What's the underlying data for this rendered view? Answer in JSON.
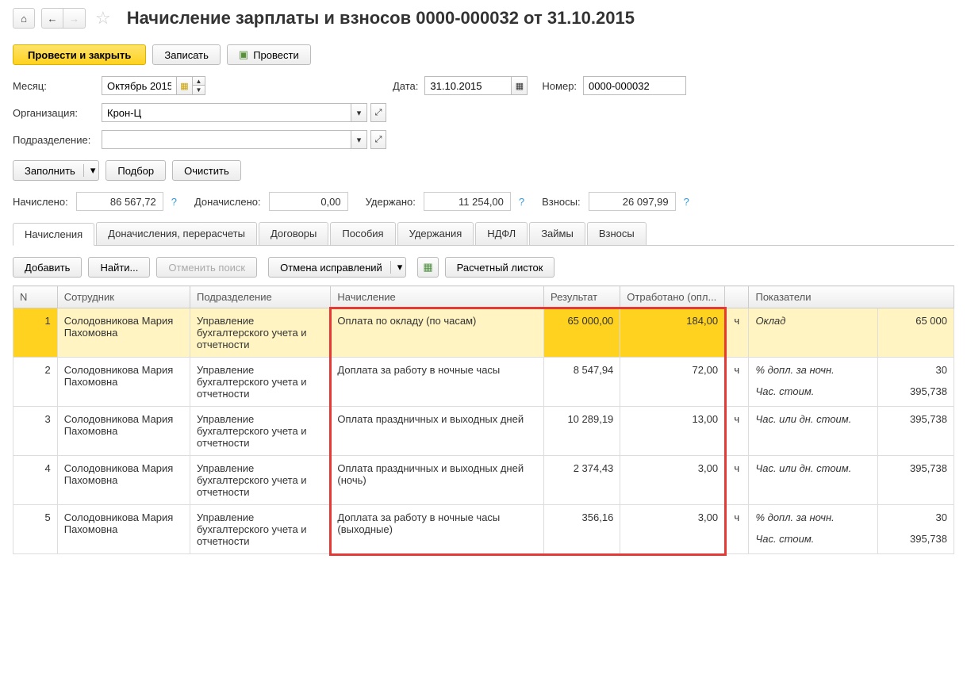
{
  "title": "Начисление зарплаты и взносов 0000-000032 от 31.10.2015",
  "actions": {
    "post_close": "Провести и закрыть",
    "save": "Записать",
    "post": "Провести"
  },
  "form": {
    "month_label": "Месяц:",
    "month_value": "Октябрь 2015",
    "date_label": "Дата:",
    "date_value": "31.10.2015",
    "number_label": "Номер:",
    "number_value": "0000-000032",
    "org_label": "Организация:",
    "org_value": "Крон-Ц",
    "dep_label": "Подразделение:",
    "dep_value": ""
  },
  "buttons": {
    "fill": "Заполнить",
    "select": "Подбор",
    "clear": "Очистить",
    "add": "Добавить",
    "find": "Найти...",
    "cancel_search": "Отменить поиск",
    "cancel_corr": "Отмена исправлений",
    "payslip": "Расчетный листок"
  },
  "summary": {
    "accrued_label": "Начислено:",
    "accrued_value": "86 567,72",
    "add_accrued_label": "Доначислено:",
    "add_accrued_value": "0,00",
    "withheld_label": "Удержано:",
    "withheld_value": "11 254,00",
    "contrib_label": "Взносы:",
    "contrib_value": "26 097,99"
  },
  "tabs": [
    "Начисления",
    "Доначисления, перерасчеты",
    "Договоры",
    "Пособия",
    "Удержания",
    "НДФЛ",
    "Займы",
    "Взносы"
  ],
  "columns": {
    "n": "N",
    "employee": "Сотрудник",
    "department": "Подразделение",
    "accrual": "Начисление",
    "result": "Результат",
    "worked": "Отработано (опл...",
    "indicators": "Показатели"
  },
  "rows": [
    {
      "n": "1",
      "employee": "Солодовникова Мария Пахомовна",
      "department": "Управление бухгалтерского учета и отчетности",
      "accrual": "Оплата по окладу (по часам)",
      "result": "65 000,00",
      "worked": "184,00",
      "unit": "ч",
      "indicators": [
        {
          "name": "Оклад",
          "value": "65 000"
        }
      ]
    },
    {
      "n": "2",
      "employee": "Солодовникова Мария Пахомовна",
      "department": "Управление бухгалтерского учета и отчетности",
      "accrual": "Доплата за работу в ночные часы",
      "result": "8 547,94",
      "worked": "72,00",
      "unit": "ч",
      "indicators": [
        {
          "name": "% допл. за ночн.",
          "value": "30"
        },
        {
          "name": "Час. стоим.",
          "value": "395,738"
        }
      ]
    },
    {
      "n": "3",
      "employee": "Солодовникова Мария Пахомовна",
      "department": "Управление бухгалтерского учета и отчетности",
      "accrual": "Оплата праздничных и выходных дней",
      "result": "10 289,19",
      "worked": "13,00",
      "unit": "ч",
      "indicators": [
        {
          "name": "Час. или дн. стоим.",
          "value": "395,738"
        }
      ]
    },
    {
      "n": "4",
      "employee": "Солодовникова Мария Пахомовна",
      "department": "Управление бухгалтерского учета и отчетности",
      "accrual": "Оплата праздничных и выходных дней (ночь)",
      "result": "2 374,43",
      "worked": "3,00",
      "unit": "ч",
      "indicators": [
        {
          "name": "Час. или дн. стоим.",
          "value": "395,738"
        }
      ]
    },
    {
      "n": "5",
      "employee": "Солодовникова Мария Пахомовна",
      "department": "Управление бухгалтерского учета и отчетности",
      "accrual": "Доплата за работу в ночные часы (выходные)",
      "result": "356,16",
      "worked": "3,00",
      "unit": "ч",
      "indicators": [
        {
          "name": "% допл. за ночн.",
          "value": "30"
        },
        {
          "name": "Час. стоим.",
          "value": "395,738"
        }
      ]
    }
  ]
}
